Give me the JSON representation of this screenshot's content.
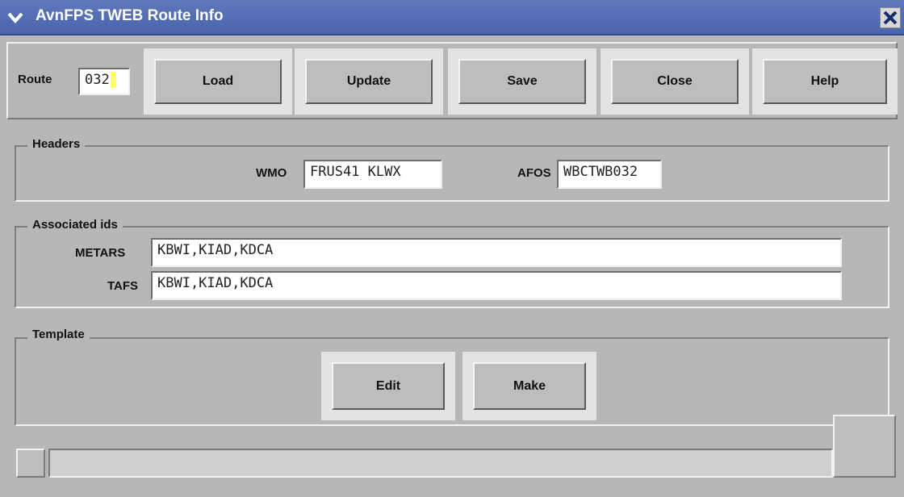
{
  "window": {
    "title": "AvnFPS TWEB Route Info"
  },
  "toolbar": {
    "route_label": "Route",
    "route_value": "032",
    "buttons": {
      "load": "Load",
      "update": "Update",
      "save": "Save",
      "close": "Close",
      "help": "Help"
    }
  },
  "headers": {
    "title": "Headers",
    "wmo_label": "WMO",
    "wmo_value": "FRUS41 KLWX",
    "afos_label": "AFOS",
    "afos_value": "WBCTWB032"
  },
  "associated": {
    "title": "Associated ids",
    "metars_label": "METARS",
    "metars_value": "KBWI,KIAD,KDCA",
    "tafs_label": "TAFS",
    "tafs_value": "KBWI,KIAD,KDCA"
  },
  "template": {
    "title": "Template",
    "edit": "Edit",
    "make": "Make"
  },
  "colors": {
    "titlebar": "#4a64ad",
    "background": "#b7b7b7",
    "field": "#ffffff"
  },
  "icons": [
    "menu-chevron-icon",
    "close-icon"
  ]
}
